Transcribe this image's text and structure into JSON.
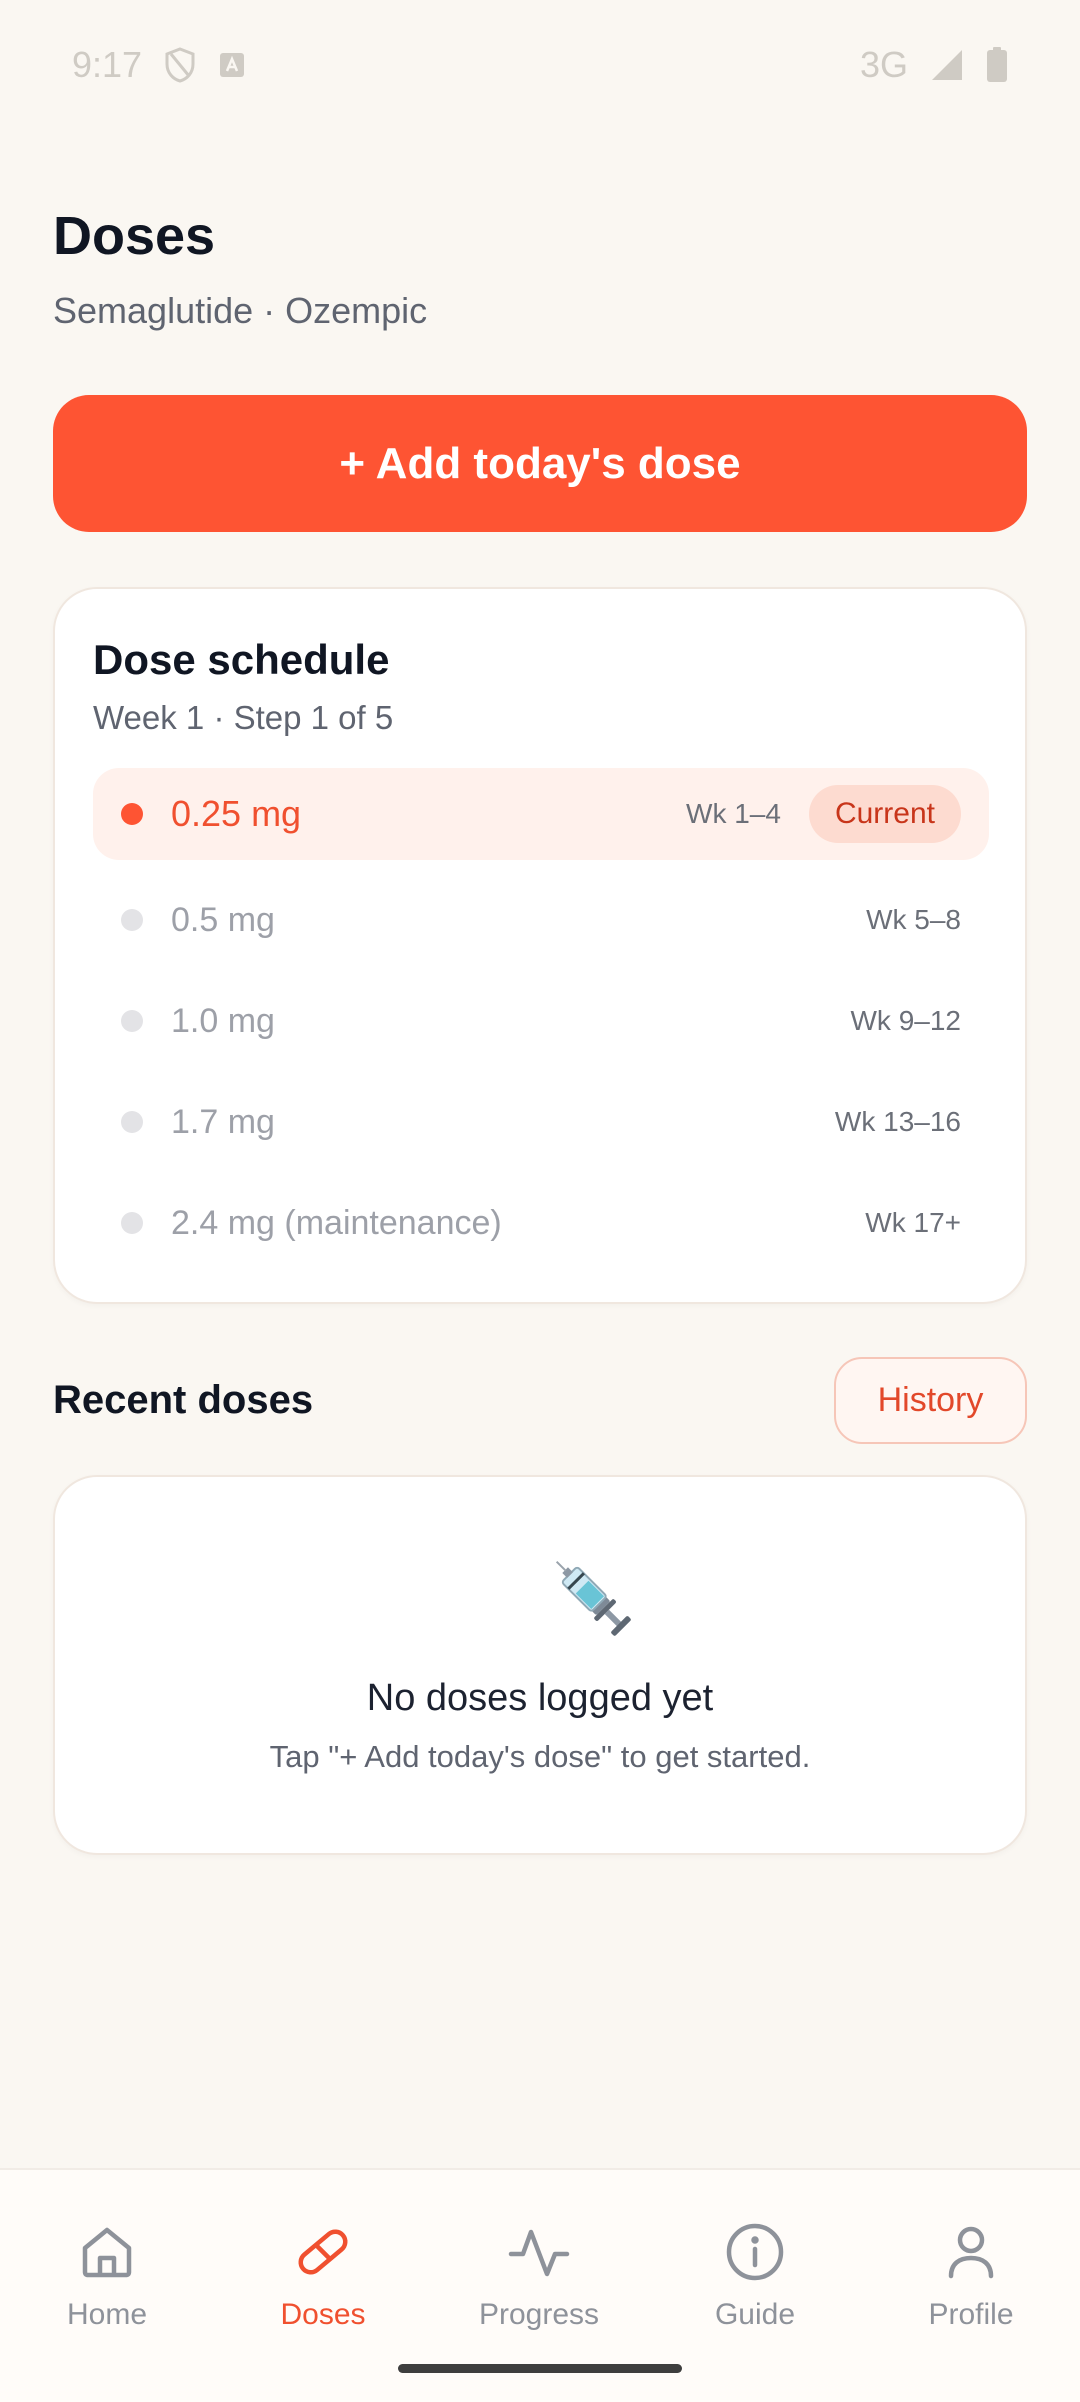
{
  "status_bar": {
    "time": "9:17",
    "network": "3G"
  },
  "header": {
    "title": "Doses",
    "subtitle": "Semaglutide · Ozempic"
  },
  "add_dose_button": {
    "label": "+ Add today's dose"
  },
  "schedule": {
    "title": "Dose schedule",
    "subtitle": "Week 1 · Step 1 of 5",
    "rows": [
      {
        "dose": "0.25 mg",
        "weeks": "Wk 1–4",
        "badge": "Current"
      },
      {
        "dose": "0.5 mg",
        "weeks": "Wk 5–8"
      },
      {
        "dose": "1.0 mg",
        "weeks": "Wk 9–12"
      },
      {
        "dose": "1.7 mg",
        "weeks": "Wk 13–16"
      },
      {
        "dose": "2.4 mg (maintenance)",
        "weeks": "Wk 17+"
      }
    ]
  },
  "recent": {
    "title": "Recent doses",
    "history_label": "History",
    "empty_icon": "syringe-icon",
    "empty_title": "No doses logged yet",
    "empty_subtitle": "Tap \"+ Add today's dose\" to get started."
  },
  "nav": {
    "items": [
      {
        "label": "Home",
        "icon": "home-icon"
      },
      {
        "label": "Doses",
        "icon": "pill-icon",
        "active": true
      },
      {
        "label": "Progress",
        "icon": "activity-icon"
      },
      {
        "label": "Guide",
        "icon": "info-icon"
      },
      {
        "label": "Profile",
        "icon": "person-icon"
      }
    ]
  },
  "colors": {
    "accent": "#FE5433",
    "background": "#FAF7F2",
    "current_bg": "#FFF1EC"
  }
}
